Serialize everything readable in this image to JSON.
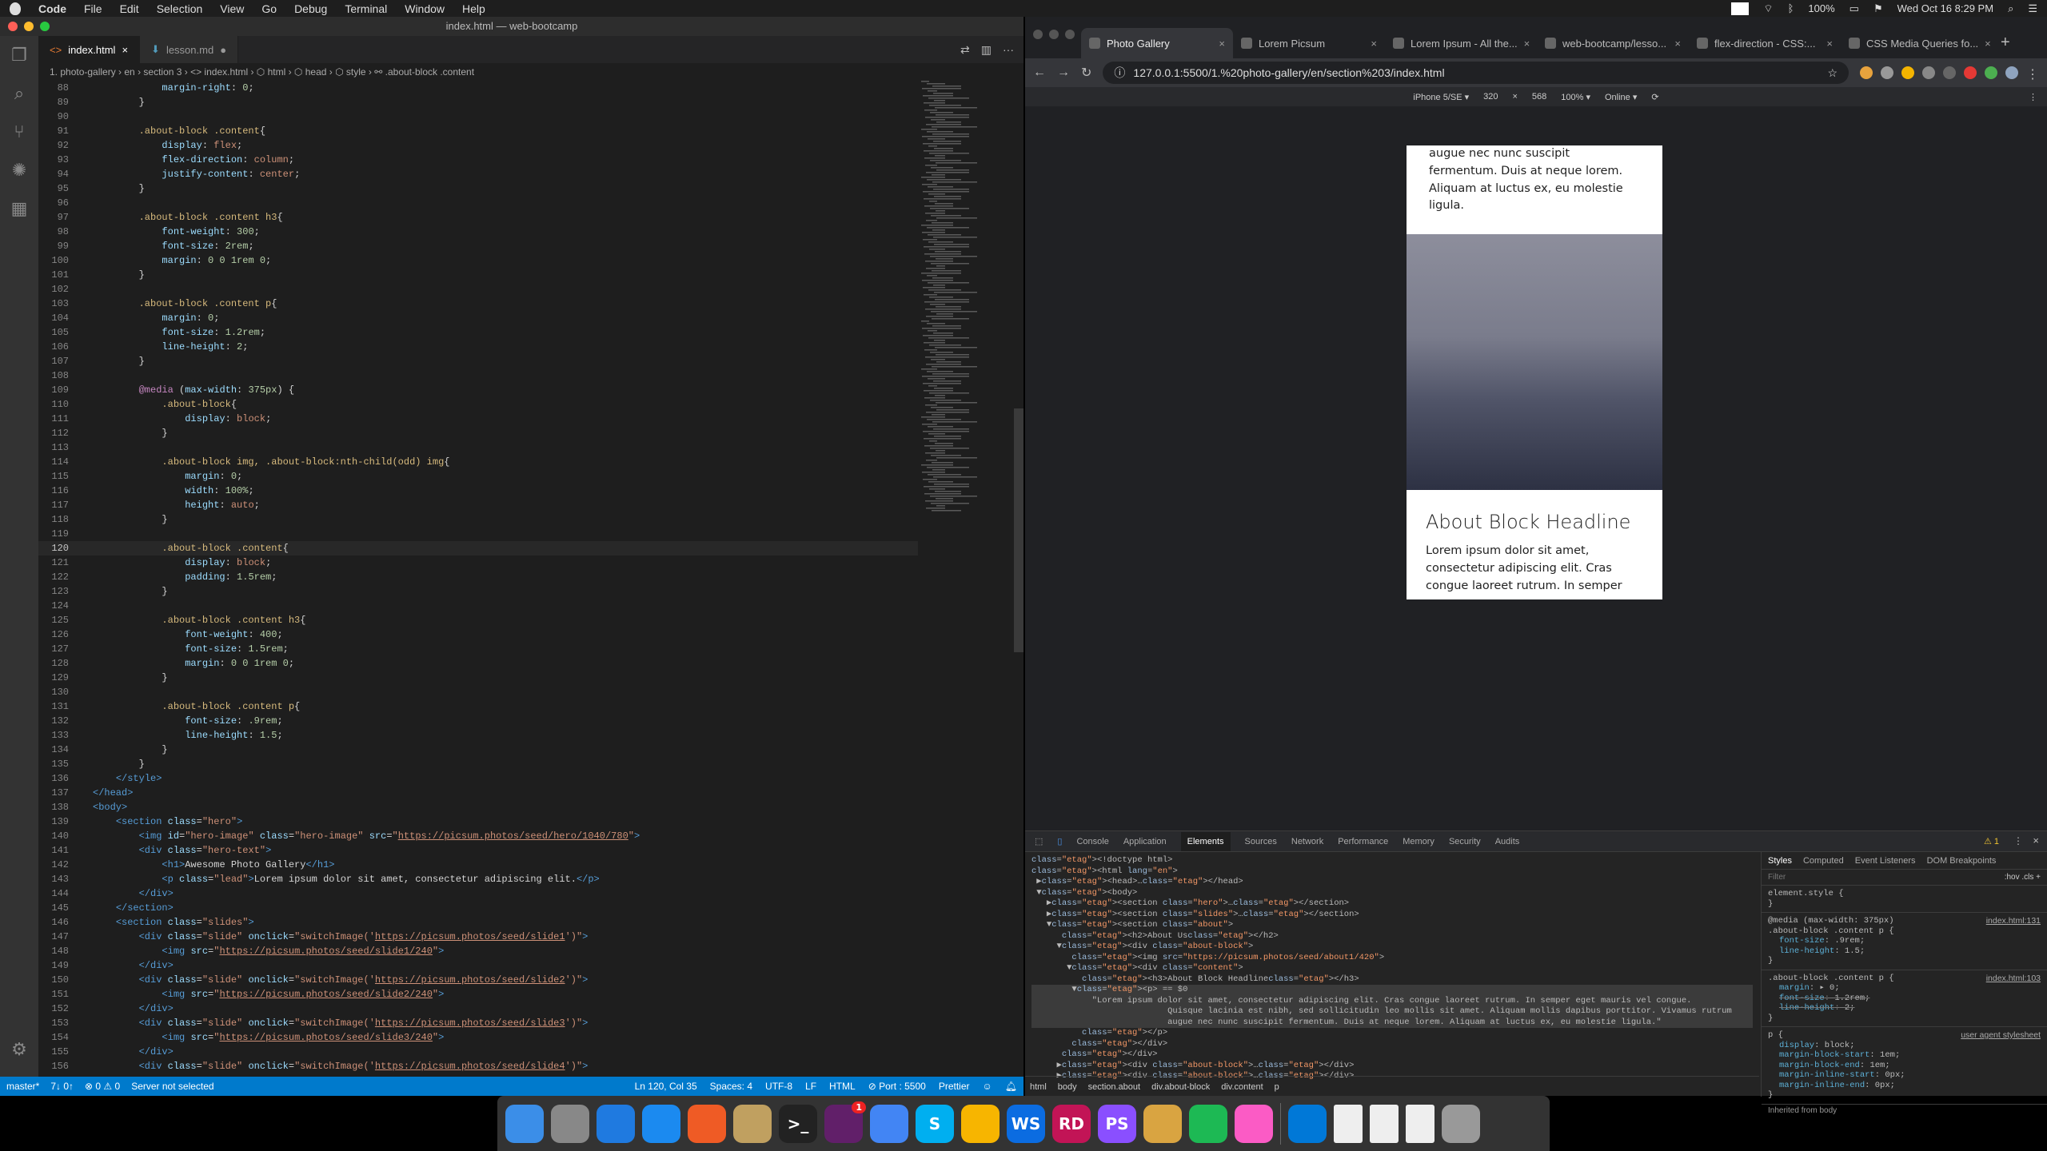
{
  "menubar": {
    "items": [
      "Code",
      "File",
      "Edit",
      "Selection",
      "View",
      "Go",
      "Debug",
      "Terminal",
      "Window",
      "Help"
    ],
    "battery": "100%",
    "datetime": "Wed Oct 16  8:29 PM"
  },
  "vscode": {
    "title": "index.html — web-bootcamp",
    "tabs": [
      {
        "label": "index.html",
        "icon": "html-icon"
      },
      {
        "label": "lesson.md",
        "icon": "markdown-icon"
      }
    ],
    "breadcrumb": "1. photo-gallery  ›  en  ›  section 3  ›  <> index.html  ›  ⬡ html  ›  ⬡ head  ›  ⬡ style  ›  ⚯ .about-block .content",
    "lines": [
      {
        "n": "88",
        "h": "<span class='p'>            margin-right</span>: <span class='n'>0</span>;"
      },
      {
        "n": "89",
        "h": "        }"
      },
      {
        "n": "90",
        "h": ""
      },
      {
        "n": "91",
        "h": "<span class='s'>        .about-block .content</span>{"
      },
      {
        "n": "92",
        "h": "<span class='p'>            display</span>: <span class='v'>flex</span>;"
      },
      {
        "n": "93",
        "h": "<span class='p'>            flex-direction</span>: <span class='v'>column</span>;"
      },
      {
        "n": "94",
        "h": "<span class='p'>            justify-content</span>: <span class='v'>center</span>;"
      },
      {
        "n": "95",
        "h": "        }"
      },
      {
        "n": "96",
        "h": ""
      },
      {
        "n": "97",
        "h": "<span class='s'>        .about-block .content h3</span>{"
      },
      {
        "n": "98",
        "h": "<span class='p'>            font-weight</span>: <span class='n'>300</span>;"
      },
      {
        "n": "99",
        "h": "<span class='p'>            font-size</span>: <span class='n'>2rem</span>;"
      },
      {
        "n": "100",
        "h": "<span class='p'>            margin</span>: <span class='n'>0 0 1rem 0</span>;"
      },
      {
        "n": "101",
        "h": "        }"
      },
      {
        "n": "102",
        "h": ""
      },
      {
        "n": "103",
        "h": "<span class='s'>        .about-block .content p</span>{"
      },
      {
        "n": "104",
        "h": "<span class='p'>            margin</span>: <span class='n'>0</span>;"
      },
      {
        "n": "105",
        "h": "<span class='p'>            font-size</span>: <span class='n'>1.2rem</span>;"
      },
      {
        "n": "106",
        "h": "<span class='p'>            line-height</span>: <span class='n'>2</span>;"
      },
      {
        "n": "107",
        "h": "        }"
      },
      {
        "n": "108",
        "h": ""
      },
      {
        "n": "109",
        "h": "<span class='k'>        @media</span> (<span class='p'>max-width</span>: <span class='n'>375px</span>) {"
      },
      {
        "n": "110",
        "h": "<span class='s'>            .about-block</span>{"
      },
      {
        "n": "111",
        "h": "<span class='p'>                display</span>: <span class='v'>block</span>;"
      },
      {
        "n": "112",
        "h": "            }"
      },
      {
        "n": "113",
        "h": ""
      },
      {
        "n": "114",
        "h": "<span class='s'>            .about-block img, .about-block:nth-child(odd) img</span>{"
      },
      {
        "n": "115",
        "h": "<span class='p'>                margin</span>: <span class='n'>0</span>;"
      },
      {
        "n": "116",
        "h": "<span class='p'>                width</span>: <span class='n'>100%</span>;"
      },
      {
        "n": "117",
        "h": "<span class='p'>                height</span>: <span class='v'>auto</span>;"
      },
      {
        "n": "118",
        "h": "            }"
      },
      {
        "n": "119",
        "h": ""
      },
      {
        "n": "120",
        "h": "<span class='s'>            .about-block .content</span>{",
        "cur": true
      },
      {
        "n": "121",
        "h": "<span class='p'>                display</span>: <span class='v'>block</span>;"
      },
      {
        "n": "122",
        "h": "<span class='p'>                padding</span>: <span class='n'>1.5rem</span>;"
      },
      {
        "n": "123",
        "h": "            }"
      },
      {
        "n": "124",
        "h": ""
      },
      {
        "n": "125",
        "h": "<span class='s'>            .about-block .content h3</span>{"
      },
      {
        "n": "126",
        "h": "<span class='p'>                font-weight</span>: <span class='n'>400</span>;"
      },
      {
        "n": "127",
        "h": "<span class='p'>                font-size</span>: <span class='n'>1.5rem</span>;"
      },
      {
        "n": "128",
        "h": "<span class='p'>                margin</span>: <span class='n'>0 0 1rem 0</span>;"
      },
      {
        "n": "129",
        "h": "            }"
      },
      {
        "n": "130",
        "h": ""
      },
      {
        "n": "131",
        "h": "<span class='s'>            .about-block .content p</span>{"
      },
      {
        "n": "132",
        "h": "<span class='p'>                font-size</span>: <span class='n'>.9rem</span>;"
      },
      {
        "n": "133",
        "h": "<span class='p'>                line-height</span>: <span class='n'>1.5</span>;"
      },
      {
        "n": "134",
        "h": "            }"
      },
      {
        "n": "135",
        "h": "        }"
      },
      {
        "n": "136",
        "h": "    <span class='t'>&lt;/style&gt;</span>"
      },
      {
        "n": "137",
        "h": "<span class='t'>&lt;/head&gt;</span>"
      },
      {
        "n": "138",
        "h": "<span class='t'>&lt;body&gt;</span>"
      },
      {
        "n": "139",
        "h": "    <span class='t'>&lt;section</span> <span class='a'>class</span>=<span class='str'>\"hero\"</span><span class='t'>&gt;</span>"
      },
      {
        "n": "140",
        "h": "        <span class='t'>&lt;img</span> <span class='a'>id</span>=<span class='str'>\"hero-image\"</span> <span class='a'>class</span>=<span class='str'>\"hero-image\"</span> <span class='a'>src</span>=<span class='str'>\"</span><span class='u'>https://picsum.photos/seed/hero/1040/780</span><span class='str'>\"</span><span class='t'>&gt;</span>"
      },
      {
        "n": "141",
        "h": "        <span class='t'>&lt;div</span> <span class='a'>class</span>=<span class='str'>\"hero-text\"</span><span class='t'>&gt;</span>"
      },
      {
        "n": "142",
        "h": "            <span class='t'>&lt;h1&gt;</span>Awesome Photo Gallery<span class='t'>&lt;/h1&gt;</span>"
      },
      {
        "n": "143",
        "h": "            <span class='t'>&lt;p</span> <span class='a'>class</span>=<span class='str'>\"lead\"</span><span class='t'>&gt;</span>Lorem ipsum dolor sit amet, consectetur adipiscing elit.<span class='t'>&lt;/p&gt;</span>"
      },
      {
        "n": "144",
        "h": "        <span class='t'>&lt;/div&gt;</span>"
      },
      {
        "n": "145",
        "h": "    <span class='t'>&lt;/section&gt;</span>"
      },
      {
        "n": "146",
        "h": "    <span class='t'>&lt;section</span> <span class='a'>class</span>=<span class='str'>\"slides\"</span><span class='t'>&gt;</span>"
      },
      {
        "n": "147",
        "h": "        <span class='t'>&lt;div</span> <span class='a'>class</span>=<span class='str'>\"slide\"</span> <span class='a'>onclick</span>=<span class='str'>\"switchImage('</span><span class='u'>https://picsum.photos/seed/slide1</span><span class='str'>')\"</span><span class='t'>&gt;</span>"
      },
      {
        "n": "148",
        "h": "            <span class='t'>&lt;img</span> <span class='a'>src</span>=<span class='str'>\"</span><span class='u'>https://picsum.photos/seed/slide1/240</span><span class='str'>\"</span><span class='t'>&gt;</span>"
      },
      {
        "n": "149",
        "h": "        <span class='t'>&lt;/div&gt;</span>"
      },
      {
        "n": "150",
        "h": "        <span class='t'>&lt;div</span> <span class='a'>class</span>=<span class='str'>\"slide\"</span> <span class='a'>onclick</span>=<span class='str'>\"switchImage('</span><span class='u'>https://picsum.photos/seed/slide2</span><span class='str'>')\"</span><span class='t'>&gt;</span>"
      },
      {
        "n": "151",
        "h": "            <span class='t'>&lt;img</span> <span class='a'>src</span>=<span class='str'>\"</span><span class='u'>https://picsum.photos/seed/slide2/240</span><span class='str'>\"</span><span class='t'>&gt;</span>"
      },
      {
        "n": "152",
        "h": "        <span class='t'>&lt;/div&gt;</span>"
      },
      {
        "n": "153",
        "h": "        <span class='t'>&lt;div</span> <span class='a'>class</span>=<span class='str'>\"slide\"</span> <span class='a'>onclick</span>=<span class='str'>\"switchImage('</span><span class='u'>https://picsum.photos/seed/slide3</span><span class='str'>')\"</span><span class='t'>&gt;</span>"
      },
      {
        "n": "154",
        "h": "            <span class='t'>&lt;img</span> <span class='a'>src</span>=<span class='str'>\"</span><span class='u'>https://picsum.photos/seed/slide3/240</span><span class='str'>\"</span><span class='t'>&gt;</span>"
      },
      {
        "n": "155",
        "h": "        <span class='t'>&lt;/div&gt;</span>"
      },
      {
        "n": "156",
        "h": "        <span class='t'>&lt;div</span> <span class='a'>class</span>=<span class='str'>\"slide\"</span> <span class='a'>onclick</span>=<span class='str'>\"switchImage('</span><span class='u'>https://picsum.photos/seed/slide4</span><span class='str'>')\"</span><span class='t'>&gt;</span>"
      }
    ],
    "status": {
      "branch": "master*",
      "sync": "7↓ 0↑",
      "problems": "⊗ 0  ⚠ 0",
      "server": "Server not selected",
      "position": "Ln 120, Col 35",
      "spaces": "Spaces: 4",
      "encoding": "UTF-8",
      "eol": "LF",
      "language": "HTML",
      "port": "⊘ Port : 5500",
      "formatter": "Prettier"
    }
  },
  "chrome": {
    "tabs": [
      {
        "label": "Photo Gallery",
        "active": true
      },
      {
        "label": "Lorem Picsum"
      },
      {
        "label": "Lorem Ipsum - All the..."
      },
      {
        "label": "web-bootcamp/lesso..."
      },
      {
        "label": "flex-direction - CSS:..."
      },
      {
        "label": "CSS Media Queries fo..."
      }
    ],
    "url": "127.0.0.1:5500/1.%20photo-gallery/en/section%203/index.html",
    "device": {
      "name": "iPhone 5/SE ▾",
      "width": "320",
      "x": "×",
      "height": "568",
      "zoom": "100% ▾",
      "network": "Online ▾"
    },
    "page": {
      "top_text": "augue nec nunc suscipit fermentum. Duis at neque lorem. Aliquam at luctus ex, eu molestie ligula.",
      "headline": "About Block Headline",
      "body": "Lorem ipsum dolor sit amet, consectetur adipiscing elit. Cras congue laoreet rutrum. In semper"
    },
    "devtools": {
      "tabs": [
        "Console",
        "Application",
        "Elements",
        "Sources",
        "Network",
        "Performance",
        "Memory",
        "Security",
        "Audits"
      ],
      "active_tab": "Elements",
      "warnings": "⚠ 1",
      "dom": [
        "<!doctype html>",
        "<html lang=\"en\">",
        " ▶<head>…</head>",
        " ▼<body>",
        "   ▶<section class=\"hero\">…</section>",
        "   ▶<section class=\"slides\">…</section>",
        "   ▼<section class=\"about\">",
        "      <h2>About Us</h2>",
        "     ▼<div class=\"about-block\">",
        "        <img src=\"https://picsum.photos/seed/about1/420\">",
        "       ▼<div class=\"content\">",
        "          <h3>About Block Headline</h3>",
        "        ▼<p> == $0",
        "            \"Lorem ipsum dolor sit amet, consectetur adipiscing elit. Cras congue laoreet rutrum. In semper eget mauris vel congue.",
        "                           Quisque lacinia est nibh, sed sollicitudin leo mollis sit amet. Aliquam mollis dapibus porttitor. Vivamus rutrum",
        "                           augue nec nunc suscipit fermentum. Duis at neque lorem. Aliquam at luctus ex, eu molestie ligula.\"",
        "          </p>",
        "        </div>",
        "      </div>",
        "     ▶<div class=\"about-block\">…</div>",
        "     ▶<div class=\"about-block\">…</div>",
        "    </section>"
      ],
      "path": [
        "html",
        "body",
        "section.about",
        "div.about-block",
        "div.content",
        "p"
      ],
      "styles_tabs": [
        "Styles",
        "Computed",
        "Event Listeners",
        "DOM Breakpoints"
      ],
      "filter": "Filter",
      "filter_right": ":hov  .cls  +",
      "rules": [
        {
          "sel": "element.style {",
          "props": [],
          "src": ""
        },
        {
          "sel": "@media (max-width: 375px)\n.about-block .content p {",
          "props": [
            "font-size: .9rem;",
            "line-height: 1.5;"
          ],
          "strike": [],
          "src": "index.html:131"
        },
        {
          "sel": ".about-block .content p {",
          "props": [
            "margin: ▸ 0;",
            "font-size: 1.2rem;",
            "line-height: 2;"
          ],
          "strike": [
            1,
            2
          ],
          "src": "index.html:103"
        },
        {
          "sel": "p {",
          "props": [
            "display: block;",
            "margin-block-start: 1em;",
            "margin-block-end: 1em;",
            "margin-inline-start: 0px;",
            "margin-inline-end: 0px;"
          ],
          "strike": [],
          "src": "user agent stylesheet"
        }
      ],
      "inherited": "Inherited from body"
    }
  },
  "dock": [
    {
      "name": "finder-icon",
      "c": "#3b8ee8"
    },
    {
      "name": "launchpad-icon",
      "c": "#888"
    },
    {
      "name": "safari-icon",
      "c": "#1f7ae0"
    },
    {
      "name": "app-store-icon",
      "c": "#1b8af0"
    },
    {
      "name": "postman-icon",
      "c": "#ef5b25"
    },
    {
      "name": "mongo-icon",
      "c": "#c0a060"
    },
    {
      "name": "terminal-icon",
      "c": "#222"
    },
    {
      "name": "slack-icon",
      "c": "#611f69"
    },
    {
      "name": "chrome-icon",
      "c": "#4285f4"
    },
    {
      "name": "skype-icon",
      "c": "#00aff0"
    },
    {
      "name": "sketch-icon",
      "c": "#f7b500"
    },
    {
      "name": "webstorm-icon",
      "c": "#0b6ce1"
    },
    {
      "name": "rider-icon",
      "c": "#c21456"
    },
    {
      "name": "phpstorm-icon",
      "c": "#8a4fff"
    },
    {
      "name": "sequel-icon",
      "c": "#d9a441"
    },
    {
      "name": "spotify-icon",
      "c": "#1db954"
    },
    {
      "name": "itunes-icon",
      "c": "#fb5bc5"
    },
    {
      "name": "vscode-icon",
      "c": "#0078d7"
    },
    {
      "name": "document-icon",
      "c": "#eee"
    },
    {
      "name": "document-icon",
      "c": "#eee"
    },
    {
      "name": "document-icon",
      "c": "#eee"
    },
    {
      "name": "trash-icon",
      "c": "#999"
    }
  ],
  "dock_labels": {
    "webstorm": "WS",
    "rider": "RD",
    "phpstorm": "PS",
    "skype": "S",
    "slack_badge": "1"
  }
}
